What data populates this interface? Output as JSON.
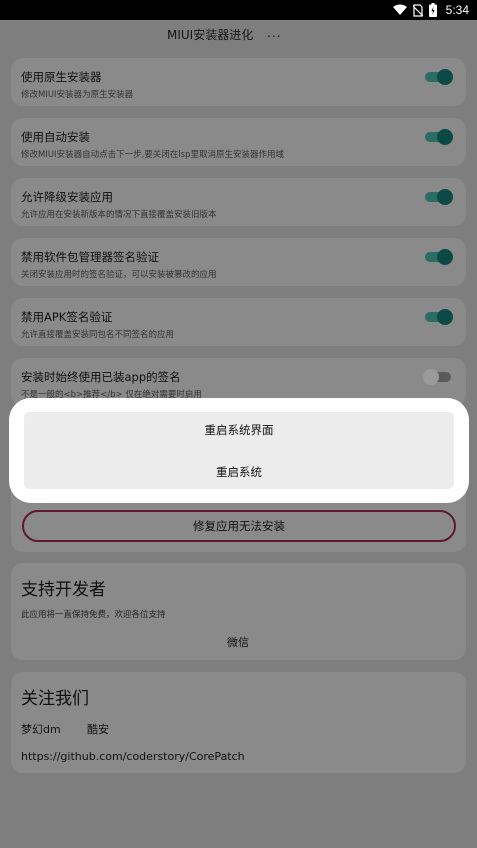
{
  "status_bar": {
    "time": "5:34",
    "icons": [
      "wifi-icon",
      "sim-off-icon",
      "battery-charging-icon"
    ]
  },
  "app_bar": {
    "title": "MIUI安装器进化",
    "overflow": "..."
  },
  "settings": [
    {
      "title": "使用原生安装器",
      "desc": "修改MIUI安装器为原生安装器",
      "enabled": true
    },
    {
      "title": "使用自动安装",
      "desc": "修改MIUI安装器自动点击下一步,要关闭在lsp里取消原生安装器作用域",
      "enabled": true
    },
    {
      "title": "允许降级安装应用",
      "desc": "允许应用在安装新版本的情况下直接覆盖安装旧版本",
      "enabled": true
    },
    {
      "title": "禁用软件包管理器签名验证",
      "desc": "关闭安装应用时的签名验证，可以安装被篡改的应用",
      "enabled": true
    },
    {
      "title": "禁用APK签名验证",
      "desc": "允许直接覆盖安装同包名不同签名的应用",
      "enabled": true
    },
    {
      "title": "安装时始终使用已装app的签名",
      "desc": "不是一般的<b>推荐</b> 仅在绝对需要时启用",
      "enabled": false
    }
  ],
  "dialog": {
    "restart_ui": "重启系统界面",
    "restart_system": "重启系统"
  },
  "repair_button": "修复应用无法安装",
  "support": {
    "heading": "支持开发者",
    "text": "此应用将一直保持免费，欢迎各位支持",
    "wechat": "微信"
  },
  "follow": {
    "heading": "关注我们",
    "author1": "梦幻dm",
    "author2": "酷安",
    "link": "https://github.com/coderstory/CorePatch"
  },
  "colors": {
    "switch_on": "#0b4a44",
    "repair_border": "#5e1836",
    "scrim_background": "#7e7e7e",
    "dialog_background": "#ffffff"
  }
}
